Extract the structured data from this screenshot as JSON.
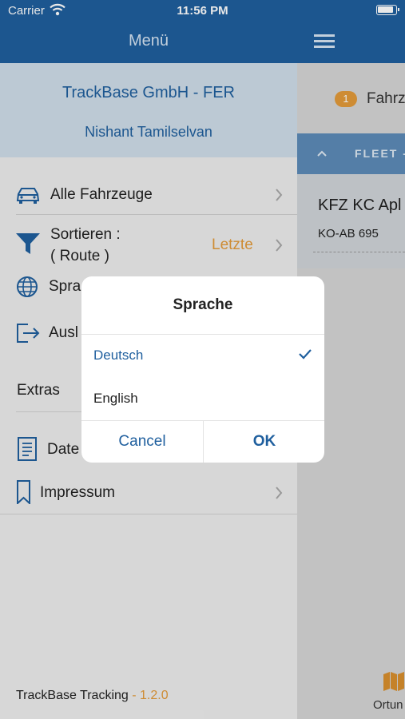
{
  "status_bar": {
    "carrier": "Carrier",
    "time": "11:56 PM"
  },
  "drawer": {
    "title": "Menü",
    "company": "TrackBase GmbH - FER",
    "user": "Nishant Tamilselvan",
    "items": [
      {
        "label": "Alle Fahrzeuge",
        "icon": "car-icon"
      },
      {
        "label": "Sortieren :",
        "label2": "( Route )",
        "value": "Letzte",
        "icon": "filter-icon"
      },
      {
        "label": "Spra",
        "icon": "globe-icon"
      },
      {
        "label": "Ausl",
        "icon": "logout-icon"
      }
    ],
    "section_extras": "Extras",
    "extras": [
      {
        "label": "Date",
        "icon": "document-icon"
      },
      {
        "label": "Impressum",
        "icon": "bookmark-icon"
      }
    ],
    "footer_app": "TrackBase Tracking",
    "footer_version": " - 1.2.0"
  },
  "main": {
    "counter": "1",
    "counter_label": "Fahrz",
    "fleet_label": "FLEET -",
    "vehicle_name": "KFZ KC Apl",
    "vehicle_plate": "KO-AB 695",
    "bottom_tab_label": "Ortun"
  },
  "dialog": {
    "title": "Sprache",
    "options": [
      {
        "label": "Deutsch",
        "selected": true
      },
      {
        "label": "English",
        "selected": false
      }
    ],
    "cancel": "Cancel",
    "ok": "OK"
  },
  "colors": {
    "primary": "#1f5f9e",
    "accent": "#e39a3a"
  }
}
